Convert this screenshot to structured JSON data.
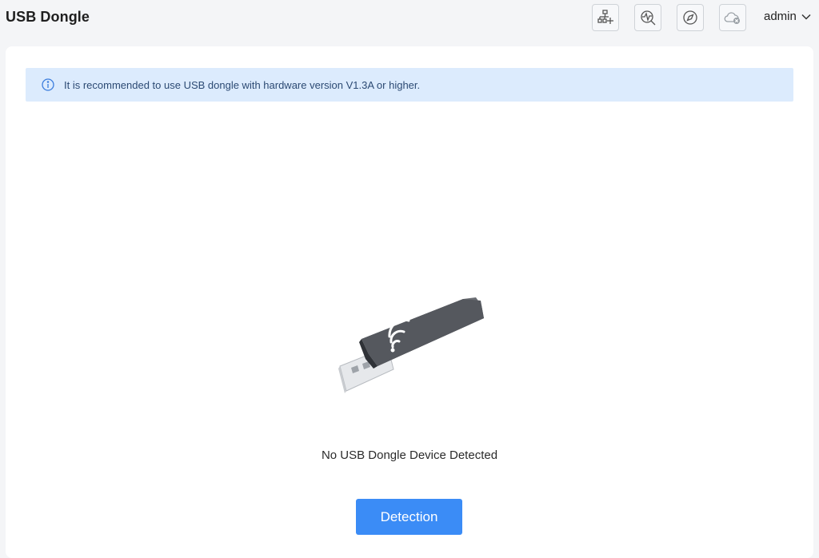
{
  "header": {
    "title": "USB Dongle",
    "user_label": "admin",
    "icons": [
      "network-add-icon",
      "diagnostics-icon",
      "compass-icon",
      "cloud-disconnected-icon",
      "chevron-down-icon"
    ]
  },
  "notice": {
    "text": "It is recommended to use USB dongle with hardware version V1.3A or higher.",
    "icon": "info-icon"
  },
  "main": {
    "illustration": "usb-dongle-icon",
    "empty_message": "No USB Dongle Device Detected",
    "detect_button_label": "Detection"
  },
  "colors": {
    "accent": "#3b8cf6",
    "notice_bg": "#dcebfd",
    "notice_text": "#2c4a73",
    "page_bg": "#f4f5f7"
  }
}
